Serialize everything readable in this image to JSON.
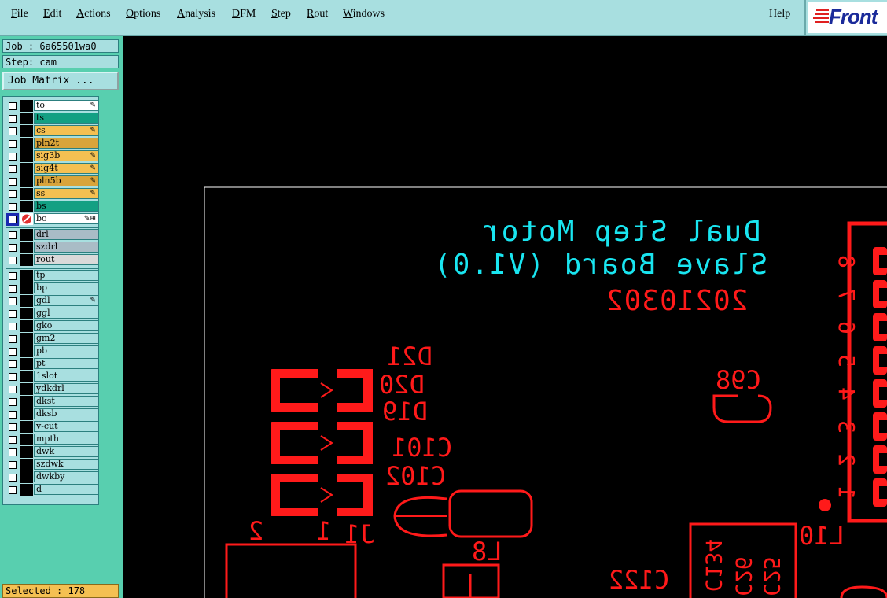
{
  "menubar": {
    "items": [
      {
        "label": "File",
        "underline": "F",
        "rest": "ile"
      },
      {
        "label": "Edit",
        "underline": "E",
        "rest": "dit"
      },
      {
        "label": "Actions",
        "underline": "A",
        "rest": "ctions"
      },
      {
        "label": "Options",
        "underline": "O",
        "rest": "ptions"
      },
      {
        "label": "Analysis",
        "underline": "A",
        "rest": "nalysis"
      },
      {
        "label": "DFM",
        "underline": "D",
        "rest": "FM"
      },
      {
        "label": "Step",
        "underline": "S",
        "rest": "tep"
      },
      {
        "label": "Rout",
        "underline": "R",
        "rest": "out"
      },
      {
        "label": "Windows",
        "underline": "W",
        "rest": "indows"
      }
    ],
    "help": "Help",
    "logo": "Front"
  },
  "left": {
    "job": "Job : 6a65501wa0",
    "step": "Step: cam",
    "job_matrix": "Job Matrix ...",
    "selected": "Selected : 178"
  },
  "layers": [
    {
      "name": "to",
      "color": "#ffffff",
      "mark": "✎"
    },
    {
      "name": "ts",
      "color": "#13a083",
      "mark": ""
    },
    {
      "name": "cs",
      "color": "#f4c052",
      "mark": "✎"
    },
    {
      "name": "pln2t",
      "color": "#d9a43a",
      "mark": ""
    },
    {
      "name": "sig3b",
      "color": "#f4c052",
      "mark": "✎"
    },
    {
      "name": "sig4t",
      "color": "#f4c052",
      "mark": "✎"
    },
    {
      "name": "pln5b",
      "color": "#d9a43a",
      "mark": "✎"
    },
    {
      "name": "ss",
      "color": "#f4c052",
      "mark": "✎"
    },
    {
      "name": "bs",
      "color": "#13a083",
      "mark": ""
    },
    {
      "name": "bo",
      "color": "#ffffff",
      "mark": "✎⊞",
      "active": true
    },
    {
      "name": "drl",
      "color": "#a9bcc6",
      "mark": ""
    },
    {
      "name": "szdrl",
      "color": "#a9bcc6",
      "mark": ""
    },
    {
      "name": "rout",
      "color": "#d9d9d9",
      "mark": ""
    },
    {
      "name": "tp",
      "color": "#a8dfe0",
      "mark": ""
    },
    {
      "name": "bp",
      "color": "#a8dfe0",
      "mark": ""
    },
    {
      "name": "gdl",
      "color": "#a8dfe0",
      "mark": "✎"
    },
    {
      "name": "ggl",
      "color": "#a8dfe0",
      "mark": ""
    },
    {
      "name": "gko",
      "color": "#a8dfe0",
      "mark": ""
    },
    {
      "name": "gm2",
      "color": "#a8dfe0",
      "mark": ""
    },
    {
      "name": "pb",
      "color": "#a8dfe0",
      "mark": ""
    },
    {
      "name": "pt",
      "color": "#a8dfe0",
      "mark": ""
    },
    {
      "name": "1slot",
      "color": "#a8dfe0",
      "mark": ""
    },
    {
      "name": "ydkdrl",
      "color": "#a8dfe0",
      "mark": ""
    },
    {
      "name": "dkst",
      "color": "#a8dfe0",
      "mark": ""
    },
    {
      "name": "dksb",
      "color": "#a8dfe0",
      "mark": ""
    },
    {
      "name": "v-cut",
      "color": "#a8dfe0",
      "mark": ""
    },
    {
      "name": "mpth",
      "color": "#a8dfe0",
      "mark": ""
    },
    {
      "name": "dwk",
      "color": "#a8dfe0",
      "mark": ""
    },
    {
      "name": "szdwk",
      "color": "#a8dfe0",
      "mark": ""
    },
    {
      "name": "dwkby",
      "color": "#a8dfe0",
      "mark": ""
    },
    {
      "name": "d",
      "color": "#a8dfe0",
      "mark": ""
    }
  ],
  "board": {
    "title1": "Dual Step Motor",
    "title2": "Slave Board (V1.0)",
    "date": "20210302",
    "labels": [
      "D21",
      "D20",
      "D19",
      "C101",
      "C102",
      "C98",
      "L8",
      "L10",
      "J1",
      "1",
      "2",
      "C122",
      "C134",
      "C26",
      "C25"
    ],
    "pin_numbers": [
      "8",
      "7",
      "6",
      "5",
      "4",
      "3",
      "2",
      "1"
    ],
    "colors": {
      "silk_cyan": "#19e5f0",
      "copper_red": "#ff1a1a",
      "outline": "#ffffff"
    }
  }
}
